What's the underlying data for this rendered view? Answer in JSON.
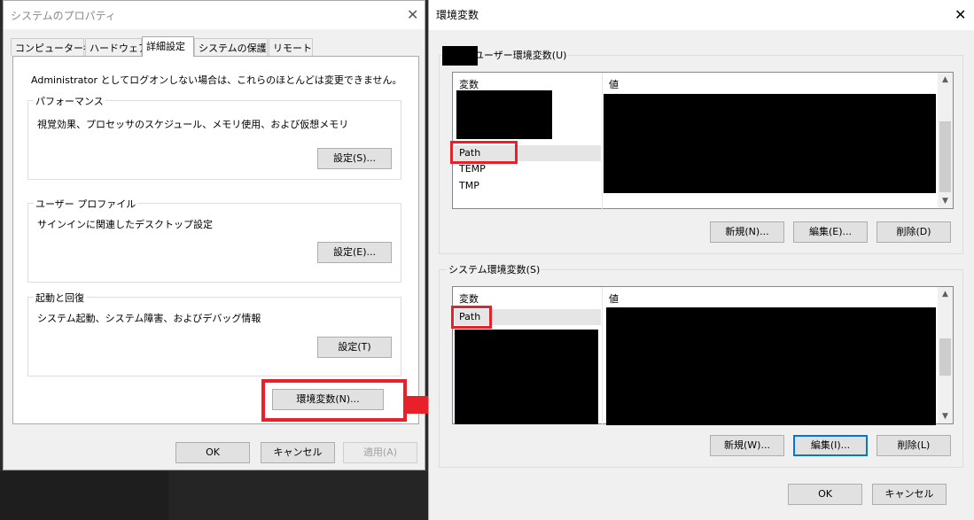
{
  "system_properties": {
    "title": "システムのプロパティ",
    "tabs": [
      "コンピューター名",
      "ハードウェア",
      "詳細設定",
      "システムの保護",
      "リモート"
    ],
    "admin_note": "Administrator としてログオンしない場合は、これらのほとんどは変更できません。",
    "performance": {
      "legend": "パフォーマンス",
      "desc": "視覚効果、プロセッサのスケジュール、メモリ使用、および仮想メモリ",
      "button": "設定(S)..."
    },
    "user_profile": {
      "legend": "ユーザー プロファイル",
      "desc": "サインインに関連したデスクトップ設定",
      "button": "設定(E)..."
    },
    "startup": {
      "legend": "起動と回復",
      "desc": "システム起動、システム障害、およびデバッグ情報",
      "button": "設定(T)"
    },
    "env_button": "環境変数(N)...",
    "ok": "OK",
    "cancel": "キャンセル",
    "apply": "適用(A)"
  },
  "env_vars": {
    "title": "環境変数",
    "user_section": {
      "legend": "のユーザー環境変数(U)",
      "col_var": "変数",
      "col_val": "値",
      "rows": [
        "Path",
        "TEMP",
        "TMP"
      ],
      "new": "新規(N)...",
      "edit": "編集(E)...",
      "delete": "削除(D)"
    },
    "system_section": {
      "legend": "システム環境変数(S)",
      "col_var": "変数",
      "col_val": "値",
      "rows": [
        "Path"
      ],
      "new": "新規(W)...",
      "edit": "編集(I)...",
      "delete": "削除(L)"
    },
    "ok": "OK",
    "cancel": "キャンセル"
  },
  "icons": {
    "close": "close-icon",
    "scroll_up": "chevron-up-icon",
    "scroll_down": "chevron-down-icon",
    "arrow": "right-arrow-icon"
  },
  "colors": {
    "highlight": "#e8202a",
    "focus": "#0078d7",
    "redaction": "#000000"
  }
}
